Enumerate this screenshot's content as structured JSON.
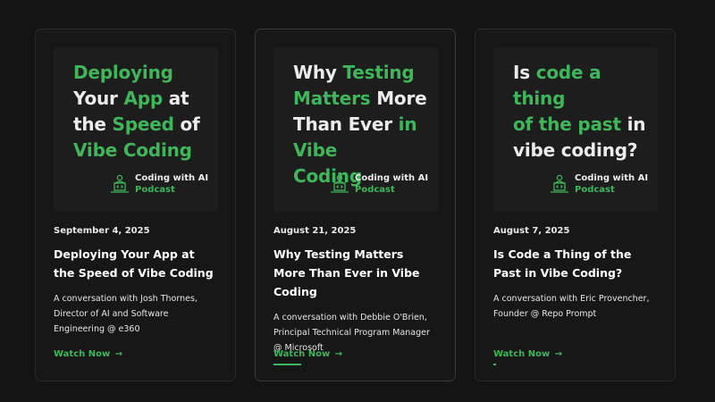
{
  "cards": [
    {
      "headline_lines": [
        [
          {
            "t": "Deploying",
            "g": true
          }
        ],
        [
          {
            "t": "Your ",
            "g": false
          },
          {
            "t": "App",
            "g": true
          },
          {
            "t": " at",
            "g": false
          }
        ],
        [
          {
            "t": "the ",
            "g": false
          },
          {
            "t": "Speed",
            "g": true
          },
          {
            "t": " of",
            "g": false
          }
        ],
        [
          {
            "t": "Vibe Coding",
            "g": true
          }
        ]
      ],
      "podcast_name": "Coding with AI",
      "podcast_label": "Podcast",
      "date": "September 4, 2025",
      "title": "Deploying Your App at the Speed of Vibe Coding",
      "description": "A conversation with Josh Thornes, Director of AI and Software Engineering @ e360",
      "watch_label": "Watch Now",
      "arrow": "→"
    },
    {
      "headline_lines": [
        [
          {
            "t": "Why ",
            "g": false
          },
          {
            "t": "Testing",
            "g": true
          }
        ],
        [
          {
            "t": "Matters",
            "g": true
          },
          {
            "t": " More",
            "g": false
          }
        ],
        [
          {
            "t": "Than Ever ",
            "g": false
          },
          {
            "t": "in Vibe",
            "g": true
          }
        ],
        [
          {
            "t": "Coding",
            "g": true
          }
        ]
      ],
      "podcast_name": "Coding with AI",
      "podcast_label": "Podcast",
      "date": "August 21, 2025",
      "title": "Why Testing Matters More Than Ever in Vibe Coding",
      "description": "A conversation with Debbie O'Brien, Principal Technical Program Manager @ Microsoft",
      "watch_label": "Watch Now",
      "arrow": "→"
    },
    {
      "headline_lines": [
        [
          {
            "t": "Is ",
            "g": false
          },
          {
            "t": "code a thing",
            "g": true
          }
        ],
        [
          {
            "t": "of the past",
            "g": true
          },
          {
            "t": " in",
            "g": false
          }
        ],
        [
          {
            "t": "vibe coding?",
            "g": false
          }
        ]
      ],
      "podcast_name": "Coding with AI",
      "podcast_label": "Podcast",
      "date": "August 7, 2025",
      "title": "Is Code a Thing of the Past in Vibe Coding?",
      "description": "A conversation with Eric Provencher, Founder @ Repo Prompt",
      "watch_label": "Watch Now",
      "arrow": "→"
    }
  ],
  "colors": {
    "background": "#141414",
    "card": "#171717",
    "accent": "#3fb65a",
    "text": "#ffffff"
  },
  "icons": {
    "podcast": "developer-laptop-icon",
    "watch": "arrow-right-icon"
  }
}
